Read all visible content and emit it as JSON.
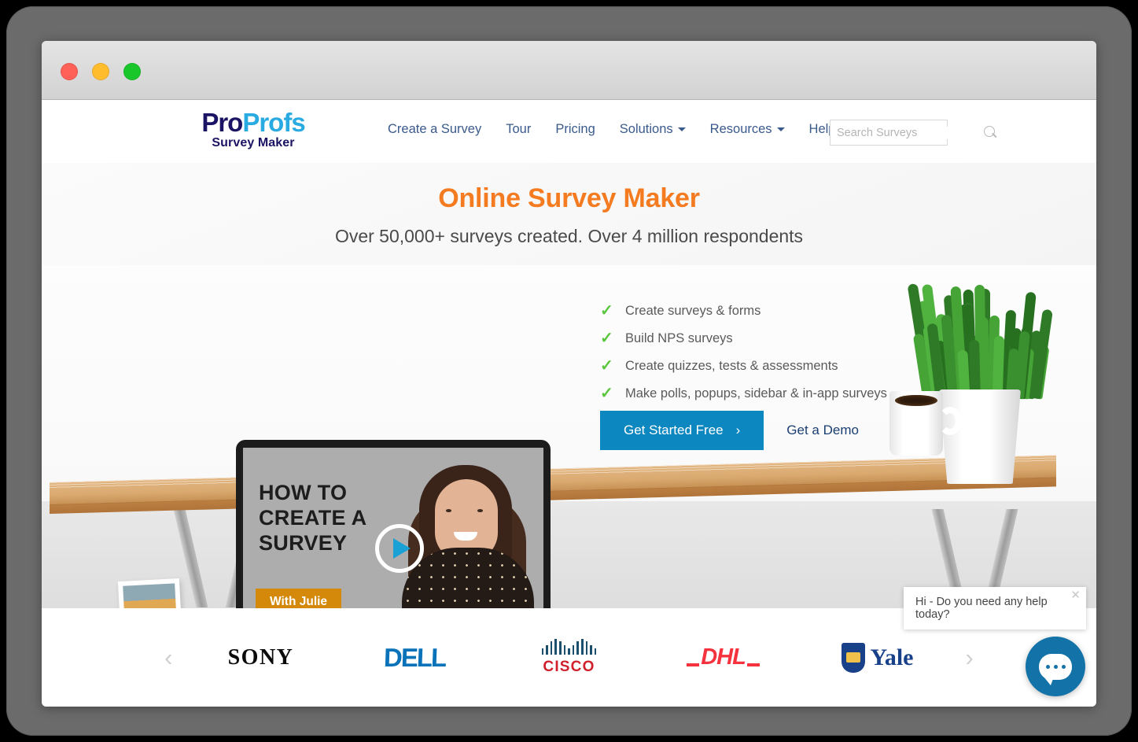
{
  "browser": {
    "traffic_lights": [
      {
        "name": "close",
        "color": "#ff6058"
      },
      {
        "name": "minimize",
        "color": "#ffbd2e"
      },
      {
        "name": "maximize",
        "color": "#1ac72b"
      }
    ]
  },
  "header": {
    "logo": {
      "part1": "Pro",
      "part2": "Profs",
      "subtitle": "Survey Maker"
    },
    "nav": [
      {
        "label": "Create a Survey",
        "has_dropdown": false
      },
      {
        "label": "Tour",
        "has_dropdown": false
      },
      {
        "label": "Pricing",
        "has_dropdown": false
      },
      {
        "label": "Solutions",
        "has_dropdown": true
      },
      {
        "label": "Resources",
        "has_dropdown": true
      },
      {
        "label": "Help",
        "has_dropdown": false
      }
    ],
    "search": {
      "placeholder": "Search Surveys",
      "value": "",
      "icon": "search-icon"
    }
  },
  "hero": {
    "title": "Online Survey Maker",
    "subtitle": "Over 50,000+ surveys created. Over 4 million respondents",
    "title_color": "#f47b20",
    "video": {
      "headline_line1": "HOW TO",
      "headline_line2": "CREATE A",
      "headline_line3": "SURVEY",
      "badge": "With Julie",
      "badge_color": "#d4890a",
      "play_icon": "play-icon"
    },
    "features": [
      "Create surveys & forms",
      "Build NPS surveys",
      "Create quizzes, tests & assessments",
      "Make polls, popups, sidebar & in-app surveys"
    ],
    "check_color": "#5cc63f",
    "cta": {
      "primary_label": "Get Started Free",
      "primary_chevron": "›",
      "primary_color": "#0d87c0",
      "secondary_label": "Get a Demo"
    }
  },
  "logo_strip": {
    "prev_arrow": "‹",
    "next_arrow": "›",
    "brands": [
      {
        "name": "SONY"
      },
      {
        "name": "DELL"
      },
      {
        "name": "CISCO"
      },
      {
        "name": "DHL"
      },
      {
        "name": "Yale"
      }
    ]
  },
  "chat": {
    "message": "Hi - Do you need any help today?",
    "close_icon": "✕",
    "button_color": "#1373a8",
    "button_icon": "chat-bubble-icon"
  }
}
